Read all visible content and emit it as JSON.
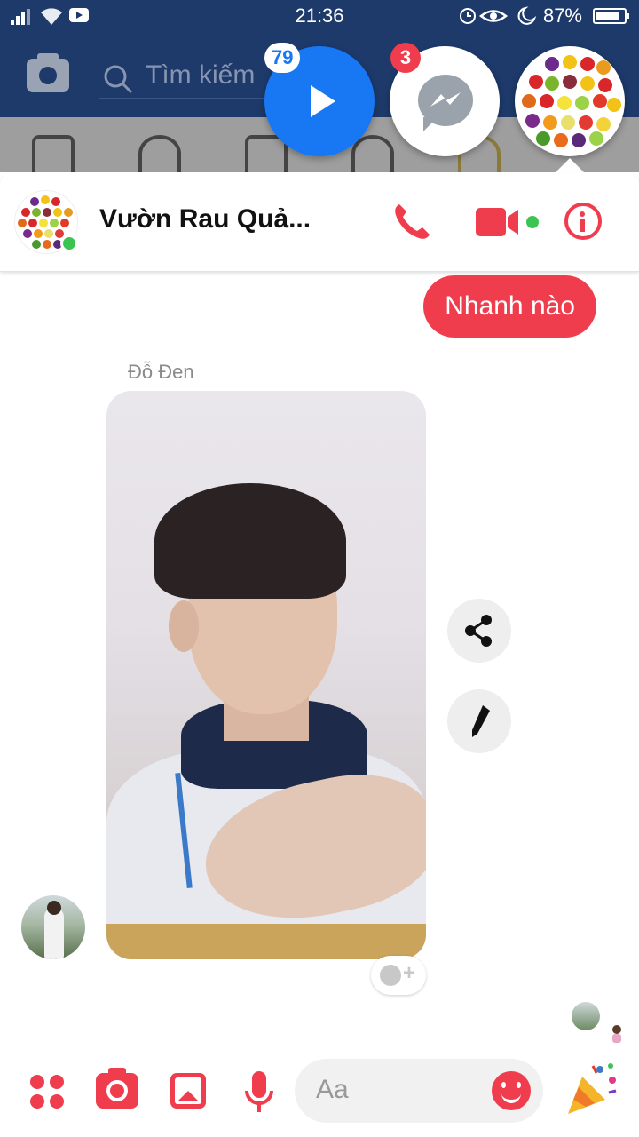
{
  "status_bar": {
    "time": "21:36",
    "battery_percent": "87%",
    "icons": [
      "signal-icon",
      "wifi-icon",
      "youtube-icon",
      "alarm-icon",
      "eye-icon",
      "moon-icon",
      "battery-icon"
    ]
  },
  "background_app": {
    "search_placeholder": "Tìm kiếm",
    "colors": {
      "header": "#1d3a6b"
    }
  },
  "chat_heads": [
    {
      "name": "video-chathead",
      "badge": "79",
      "icon": "play-icon"
    },
    {
      "name": "messenger-chathead",
      "badge": "3",
      "icon": "messenger-icon"
    },
    {
      "name": "fruit-group-chathead",
      "icon": "fruit-avatar"
    }
  ],
  "conversation": {
    "title": "Vườn Rau Quả...",
    "online": true,
    "actions": [
      "phone-icon",
      "video-call-icon",
      "info-icon"
    ]
  },
  "messages": [
    {
      "direction": "outgoing",
      "text": "Nhanh nào"
    },
    {
      "direction": "incoming",
      "sender": "Đỗ Đen",
      "type": "photo"
    }
  ],
  "composer": {
    "placeholder": "Aa",
    "tools": [
      "apps-icon",
      "camera-icon",
      "gallery-icon",
      "microphone-icon",
      "emoji-icon",
      "party-icon"
    ]
  },
  "colors": {
    "accent": "#f03d4e",
    "messenger_blue": "#1877f2",
    "online": "#3cc452"
  }
}
